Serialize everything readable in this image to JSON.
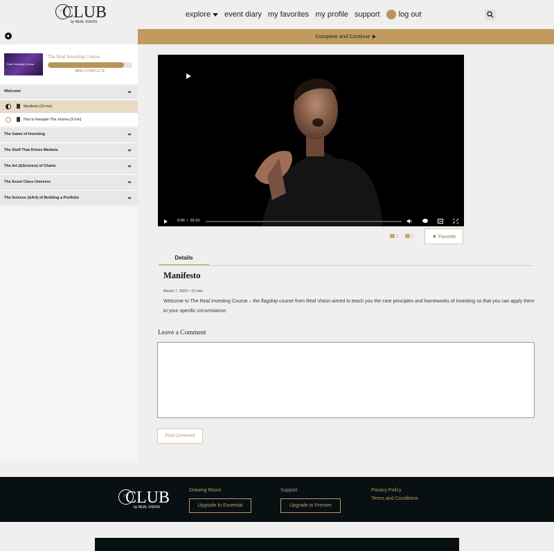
{
  "header": {
    "logo": {
      "mark": "rv",
      "name": "CLUB",
      "byline": "by REAL VISION"
    },
    "nav": {
      "explore": "explore",
      "event_diary": "event diary",
      "my_favorites": "my favorites",
      "my_profile": "my profile",
      "support": "support",
      "log_out": "log out"
    }
  },
  "complete_bar": {
    "label": "Complete and Continue"
  },
  "course": {
    "thumbnail_text": "Real Investing Course",
    "title": "The Real Investing Course",
    "progress": 0.9,
    "progress_pct": "90%",
    "progress_suffix": "COMPLETE",
    "sections": [
      {
        "label": "Welcome",
        "expanded": true
      },
      {
        "label": "The Game of Investing",
        "expanded": false
      },
      {
        "label": "The Stuff That Drives Markets",
        "expanded": false
      },
      {
        "label": "The Art (&Science) of Charts",
        "expanded": false
      },
      {
        "label": "The Asset Class Universe",
        "expanded": false
      },
      {
        "label": "The Science (&Art) of Building a Portfolio",
        "expanded": false
      }
    ],
    "lessons": [
      {
        "label": "Manifesto [10 min]",
        "status": "in-progress",
        "active": true
      },
      {
        "label": "How to Navigate This Journey [9 min]",
        "status": "not-started",
        "active": false
      }
    ]
  },
  "video": {
    "current_time": "0:00",
    "separator": "/",
    "duration": "10:10"
  },
  "reactions": {
    "likes": "0",
    "dislikes": "0",
    "favorite_label": "Favorite"
  },
  "tabs": {
    "details": "Details"
  },
  "lesson": {
    "title": "Manifesto",
    "date": "March 7, 2023",
    "bullet": "•",
    "duration": "10 min",
    "description": "Welcome to The Real Investing Course – the flagship course from Real Vision aimed to teach you the core principles and frameworks of investing so that you can apply them to your specific circumstance."
  },
  "comments": {
    "heading": "Leave a Comment",
    "post_button": "Post Comment",
    "value": ""
  },
  "footer": {
    "logo": {
      "mark": "rv",
      "name": "CLUB",
      "byline": "by REAL VISION"
    },
    "col1": {
      "link": "Drawing Room",
      "button": "Upgrade to Essential"
    },
    "col2": {
      "link": "Support",
      "button": "Upgrade to Premier"
    },
    "col3": {
      "link1": "Privacy Policy",
      "link2": "Terms and Conditions"
    }
  },
  "colors": {
    "accent": "#c09a5e",
    "footer_bg": "#081014",
    "page_bg": "#efefef"
  }
}
